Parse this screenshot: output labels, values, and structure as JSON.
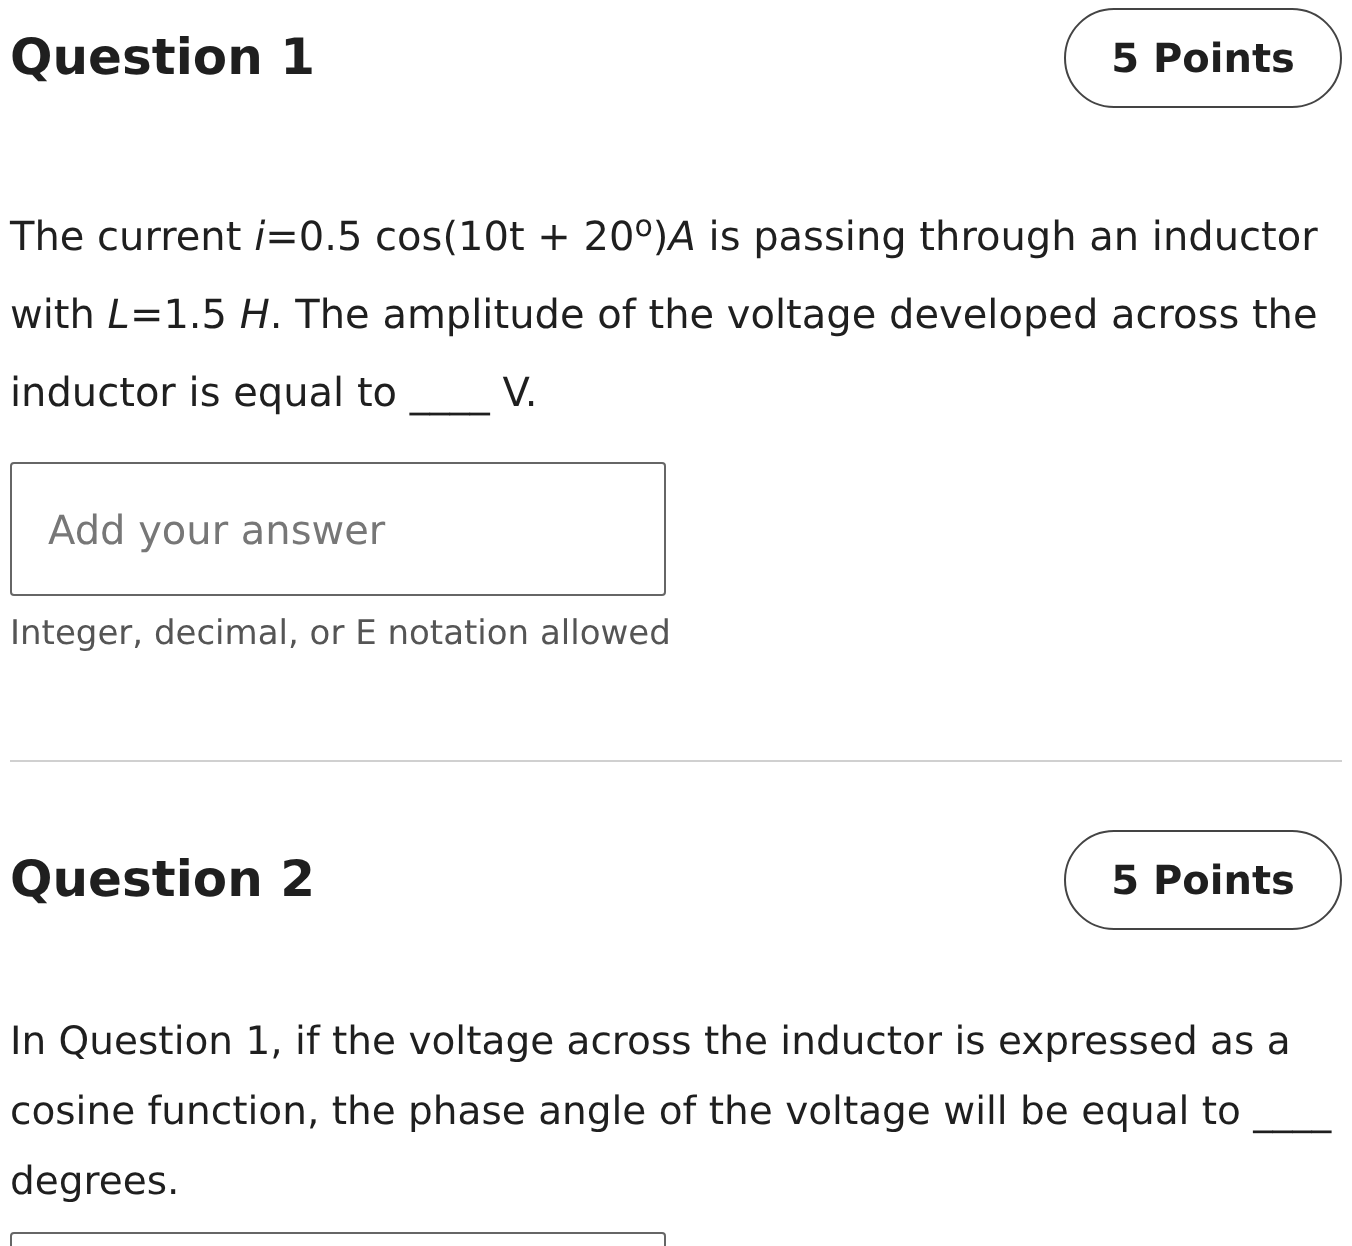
{
  "questions": [
    {
      "title": "Question 1",
      "points": "5 Points",
      "text": "The current *i*=0.5 cos(10t + 20$^{o}$)*A* is passing through an inductor with *L*=1.5 *H*. The amplitude of the voltage developed across the inductor is equal to ____ V.",
      "answer": {
        "placeholder": "Add your answer",
        "hint": "Integer, decimal, or E notation allowed"
      }
    },
    {
      "title": "Question 2",
      "points": "5 Points",
      "text": "In Question 1, if the voltage across the inductor is expressed as a cosine function, the phase angle of the voltage will be equal to ____ degrees."
    }
  ]
}
